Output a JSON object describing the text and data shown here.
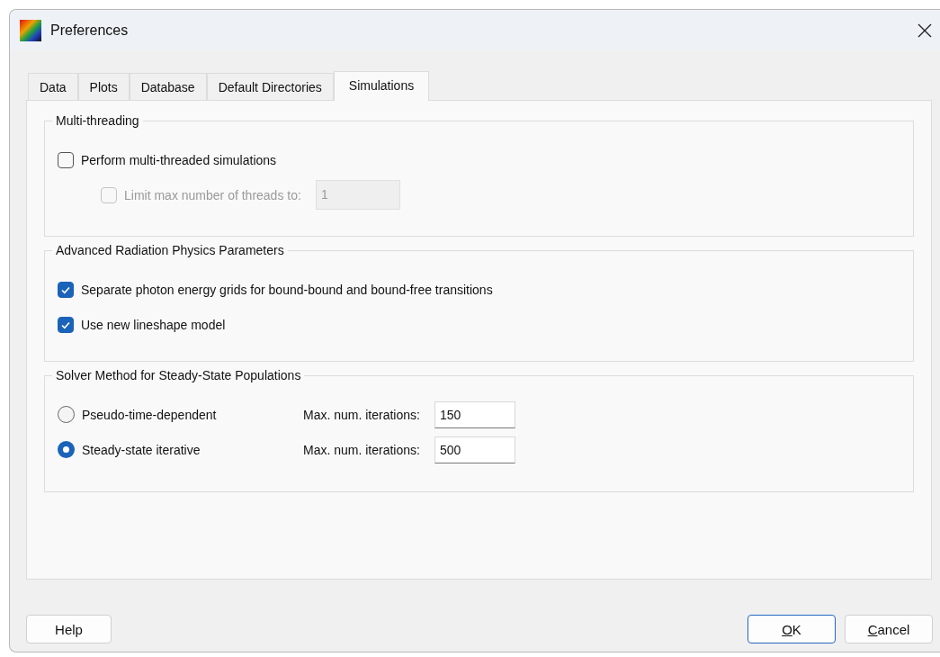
{
  "window": {
    "title": "Preferences"
  },
  "tabs": [
    {
      "label": "Data",
      "selected": false
    },
    {
      "label": "Plots",
      "selected": false
    },
    {
      "label": "Database",
      "selected": false
    },
    {
      "label": "Default Directories",
      "selected": false
    },
    {
      "label": "Simulations",
      "selected": true
    }
  ],
  "groups": [
    {
      "title": "Multi-threading",
      "rows": [
        {
          "kind": "checkbox",
          "label": "Perform multi-threaded simulations",
          "checked": false,
          "disabled": false,
          "indented": false
        },
        {
          "kind": "checkbox",
          "label": "Limit max number of threads to:",
          "checked": false,
          "disabled": true,
          "indented": true,
          "value": "1"
        }
      ]
    },
    {
      "title": "Advanced Radiation Physics Parameters",
      "rows": [
        {
          "kind": "checkbox",
          "label": "Separate photon energy grids for bound-bound and bound-free transitions",
          "checked": true,
          "disabled": false,
          "indented": false
        },
        {
          "kind": "checkbox",
          "label": "Use new lineshape model",
          "checked": true,
          "disabled": false,
          "indented": false
        }
      ]
    },
    {
      "title": "Solver Method for Steady-State Populations",
      "rows": [
        {
          "kind": "radio",
          "label": "Pseudo-time-dependent",
          "selected": false,
          "field_label": "Max. num. iterations:",
          "value": "150"
        },
        {
          "kind": "radio",
          "label": "Steady-state iterative",
          "selected": true,
          "field_label": "Max. num. iterations:",
          "value": "500"
        }
      ]
    }
  ],
  "buttons": [
    {
      "label": "Help",
      "default": false,
      "mnemonic": false
    },
    {
      "label": "OK",
      "default": true,
      "mnemonic": true
    },
    {
      "label": "Cancel",
      "default": false,
      "mnemonic": true
    }
  ]
}
